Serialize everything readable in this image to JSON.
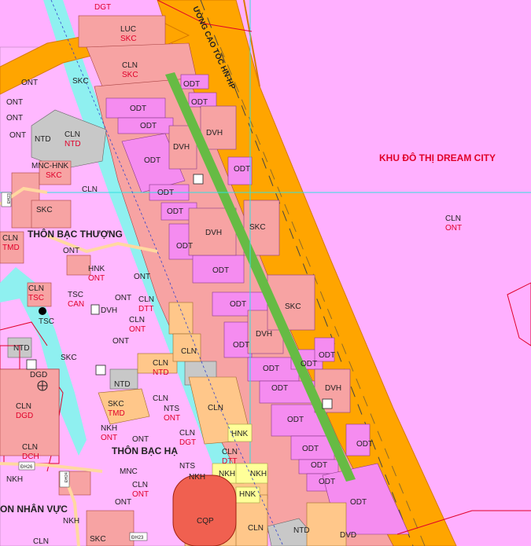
{
  "map": {
    "areas": {
      "khu_do_thi": "KHU ĐÔ THỊ DREAM CITY",
      "thon_bac_thuong": "THÔN BẠC THƯỢNG",
      "thon_bac_ha": "THÔN BẠC HẠ",
      "thon_nhan_vuc": "ON NHÂN VỰC",
      "road_name": "ƯỜNG CAO TỐC HN-HP"
    },
    "road_badges": {
      "dh23_a": "ĐH23",
      "dh26": "ĐH26",
      "dh24": "ĐH24",
      "dh23_b": "ĐH23"
    },
    "land_codes": {
      "dgt_top": "DGT",
      "luc": "LUC",
      "skc_luc": "SKC",
      "cln_1": "CLN",
      "skc_1": "SKC",
      "ont_1": "ONT",
      "ont_2": "ONT",
      "ont_3": "ONT",
      "skc_2": "SKC",
      "cln_ntd": "CLN",
      "ntd_1": "NTD",
      "ntd_2": "NTD",
      "mnc_hnk": "MNC-HNK",
      "skc_3": "SKC",
      "cln_2": "CLN",
      "skc_4": "SKC",
      "cln_tmd": "CLN",
      "tmd_1": "TMD",
      "ont_4": "ONT",
      "hnk_1": "HNK",
      "ont_5": "ONT",
      "ont_6": "ONT",
      "cln_tsc": "CLN",
      "tsc_1": "TSC",
      "tsc_can": "TSC",
      "can_1": "CAN",
      "ont_7": "ONT",
      "dvh_1": "DVH",
      "cln_dtt": "CLN",
      "dtt_1": "DTT",
      "tsc_2": "TSC",
      "cln_ont": "CLN",
      "ont_8": "ONT",
      "ont_9": "ONT",
      "ntd_3": "NTD",
      "dgd_1": "DGD",
      "skc_5": "SKC",
      "cln_ntd2": "CLN",
      "ntd_4": "NTD",
      "cln_3": "CLN",
      "ntd_5": "NTD",
      "cln_dgd": "CLN",
      "dgd_2": "DGD",
      "skc_tmd": "SKC",
      "tmd_2": "TMD",
      "nts_1": "NTS",
      "ont_10": "ONT",
      "cln_4": "CLN",
      "nkh_1": "NKH",
      "ont_11": "ONT",
      "ont_12": "ONT",
      "cln_dgt": "CLN",
      "dgt_1": "DGT",
      "hnk_2": "HNK",
      "cln_dch": "CLN",
      "dch_1": "DCH",
      "nkh_2": "NKH",
      "mnc_1": "MNC",
      "nts_2": "NTS",
      "nkh_3": "NKH",
      "cln_dtt2": "CLN",
      "dtt_2": "DTT",
      "nkh_4": "NKH",
      "nkh_5": "NKH",
      "cln_ont2": "CLN",
      "ont_13": "ONT",
      "hnk_3": "HNK",
      "ont_14": "ONT",
      "cqp_1": "CQP",
      "cln_5": "CLN",
      "cln_6": "CLN",
      "nkh_6": "NKH",
      "skc_6": "SKC",
      "cln_7": "CLN",
      "ntd_6": "NTD",
      "odt_1": "ODT",
      "odt_2": "ODT",
      "odt_3": "ODT",
      "odt_4": "ODT",
      "dvh_2": "DVH",
      "dvh_3": "DVH",
      "odt_5": "ODT",
      "odt_6": "ODT",
      "odt_7": "ODT",
      "odt_8": "ODT",
      "dvh_4": "DVH",
      "skc_7": "SKC",
      "odt_9": "ODT",
      "odt_10": "ODT",
      "odt_11": "ODT",
      "odt_12": "ODT",
      "skc_8": "SKC",
      "odt_13": "ODT",
      "dvh_5": "DVH",
      "odt_14": "ODT",
      "odt_15": "ODT",
      "odt_16": "ODT",
      "odt_17": "ODT",
      "odt_18": "ODT",
      "dvh_6": "DVH",
      "odt_19": "ODT",
      "odt_20": "ODT",
      "odt_21": "ODT",
      "odt_22": "ODT",
      "odt_23": "ODT",
      "odt_24": "ODT",
      "odt_25": "ODT",
      "odt_26": "ODT",
      "dvd_1": "DVD",
      "cln_big": "CLN",
      "ont_big": "ONT"
    },
    "colors": {
      "residential_pink": "#ffb0ff",
      "urban_magenta": "#f58cf0",
      "industrial_salmon": "#f7a3a3",
      "highway_orange": "#ffa500",
      "river_cyan": "#8ff0f0",
      "green_strip": "#66bb44",
      "cemetery_gray": "#c8c8c8",
      "cultural_peach": "#ffc78a",
      "red_lines": "#e0002a"
    }
  }
}
